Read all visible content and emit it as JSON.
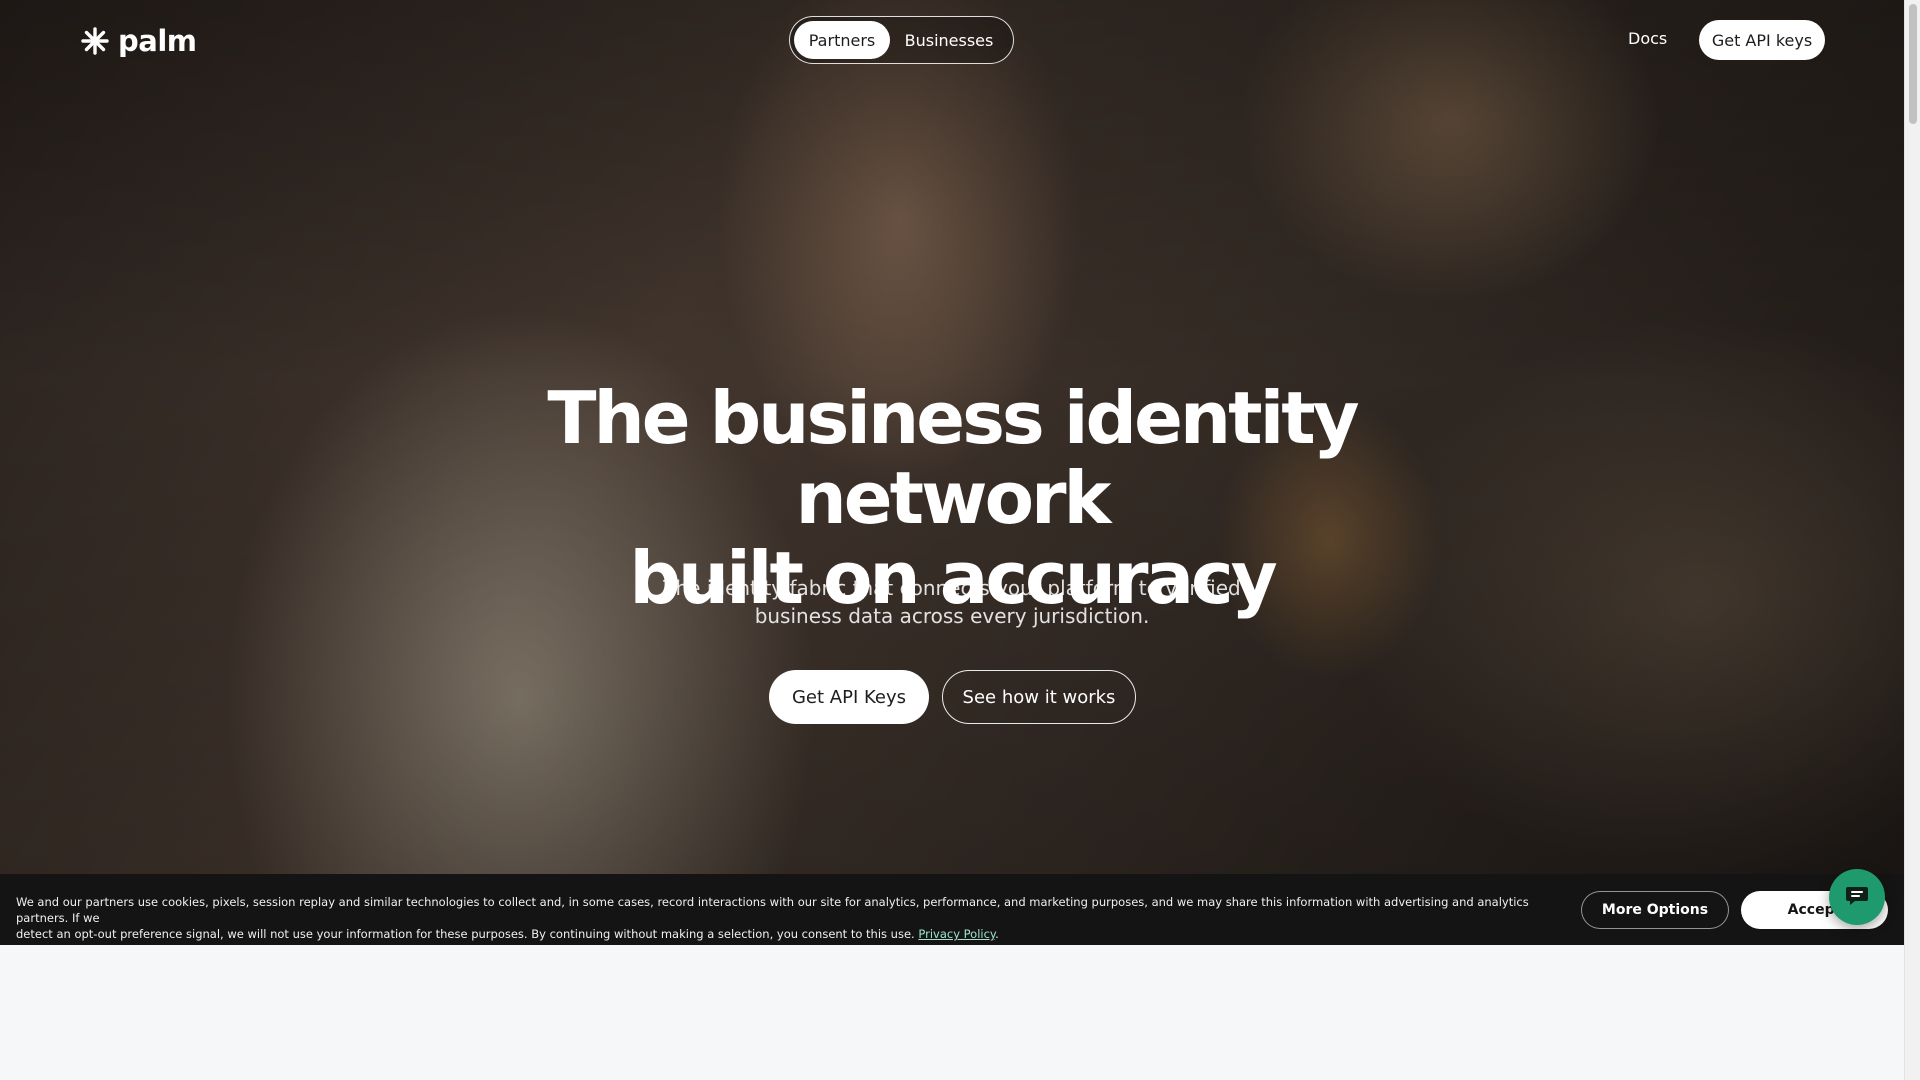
{
  "nav": {
    "logo_text": "palm",
    "segment": {
      "active": "Partners",
      "inactive": "Businesses"
    },
    "docs": "Docs",
    "get_api_keys": "Get API keys"
  },
  "hero": {
    "headline_line1": "The business identity network",
    "headline_line2": "built on accuracy",
    "subtext_line1": "The identity fabric that connects your platform to verified",
    "subtext_line2": "business data across every jurisdiction.",
    "cta_primary": "Get API Keys",
    "cta_secondary": "See how it works",
    "background_image": "chef-in-kitchen"
  },
  "cookie_banner": {
    "text_line1": "We and our partners use cookies, pixels, session replay and similar technologies to collect and, in some cases, record interactions with our site for analytics, performance, and marketing purposes, and we may share this information with advertising and analytics partners. If we",
    "text_line2": "detect an opt-out preference signal, we will not use your information for these purposes. By continuing without making a selection, you consent to this use.",
    "privacy_link": "Privacy Policy",
    "more_options": "More Options",
    "accept": "Accept"
  },
  "chat_widget": {
    "icon": "chat-bubble-icon",
    "color": "#1f9a6e"
  },
  "colors": {
    "banner_bg": "#141414",
    "page_bg": "#f6f7f9"
  }
}
